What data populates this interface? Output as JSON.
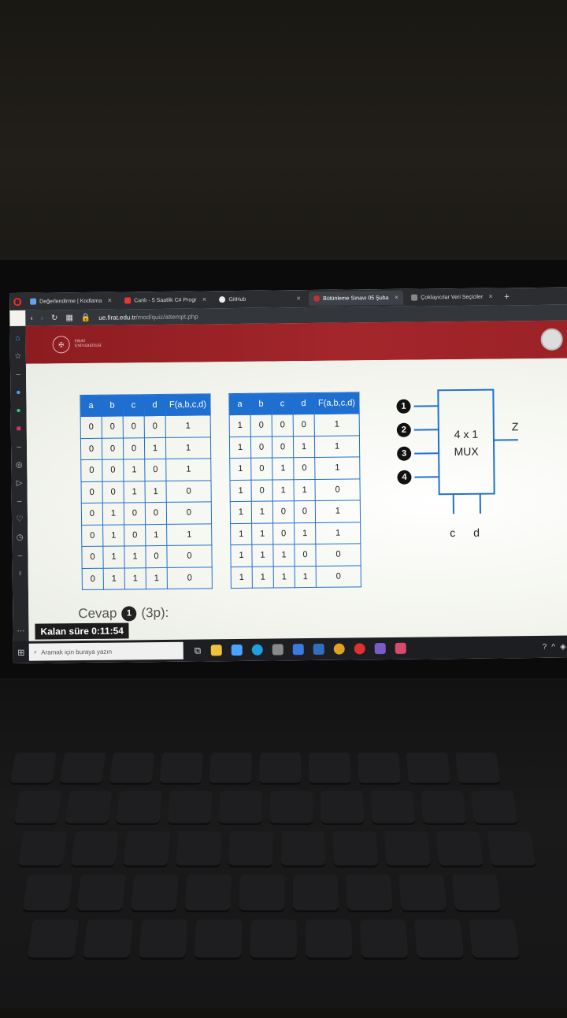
{
  "browser": {
    "tabs": [
      {
        "label": "Değerlendirme | Kodlama",
        "active": false
      },
      {
        "label": "Canlı - 5 Saatlik C# Progr",
        "active": false
      },
      {
        "label": "GitHub",
        "active": false
      },
      {
        "label": "Bütünleme Sınavı 05 Şuba",
        "active": true
      },
      {
        "label": "Çoklayıcılar Veri Seçiciler",
        "active": false
      }
    ],
    "url_host": "ue.firat.edu.tr",
    "url_path": "/mod/quiz/attempt.php"
  },
  "site": {
    "logo_text_line1": "FIRAT",
    "logo_text_line2": "ÜNİVERSİTESİ"
  },
  "truth_table": {
    "headers": [
      "a",
      "b",
      "c",
      "d",
      "F(a,b,c,d)"
    ],
    "left_rows": [
      [
        "0",
        "0",
        "0",
        "0",
        "1"
      ],
      [
        "0",
        "0",
        "0",
        "1",
        "1"
      ],
      [
        "0",
        "0",
        "1",
        "0",
        "1"
      ],
      [
        "0",
        "0",
        "1",
        "1",
        "0"
      ],
      [
        "0",
        "1",
        "0",
        "0",
        "0"
      ],
      [
        "0",
        "1",
        "0",
        "1",
        "1"
      ],
      [
        "0",
        "1",
        "1",
        "0",
        "0"
      ],
      [
        "0",
        "1",
        "1",
        "1",
        "0"
      ]
    ],
    "right_rows": [
      [
        "1",
        "0",
        "0",
        "0",
        "1"
      ],
      [
        "1",
        "0",
        "0",
        "1",
        "1"
      ],
      [
        "1",
        "0",
        "1",
        "0",
        "1"
      ],
      [
        "1",
        "0",
        "1",
        "1",
        "0"
      ],
      [
        "1",
        "1",
        "0",
        "0",
        "1"
      ],
      [
        "1",
        "1",
        "0",
        "1",
        "1"
      ],
      [
        "1",
        "1",
        "1",
        "0",
        "0"
      ],
      [
        "1",
        "1",
        "1",
        "1",
        "0"
      ]
    ]
  },
  "mux": {
    "label_line1": "4 x 1",
    "label_line2": "MUX",
    "inputs": [
      "1",
      "2",
      "3",
      "4"
    ],
    "output": "Z",
    "selects": [
      "c",
      "d"
    ]
  },
  "question": {
    "answer_label": "Cevap",
    "answer_num": "1",
    "points": "(3p):"
  },
  "timer": {
    "text": "Kalan süre 0:11:54"
  },
  "taskbar": {
    "search_placeholder": "Aramak için buraya yazın"
  }
}
